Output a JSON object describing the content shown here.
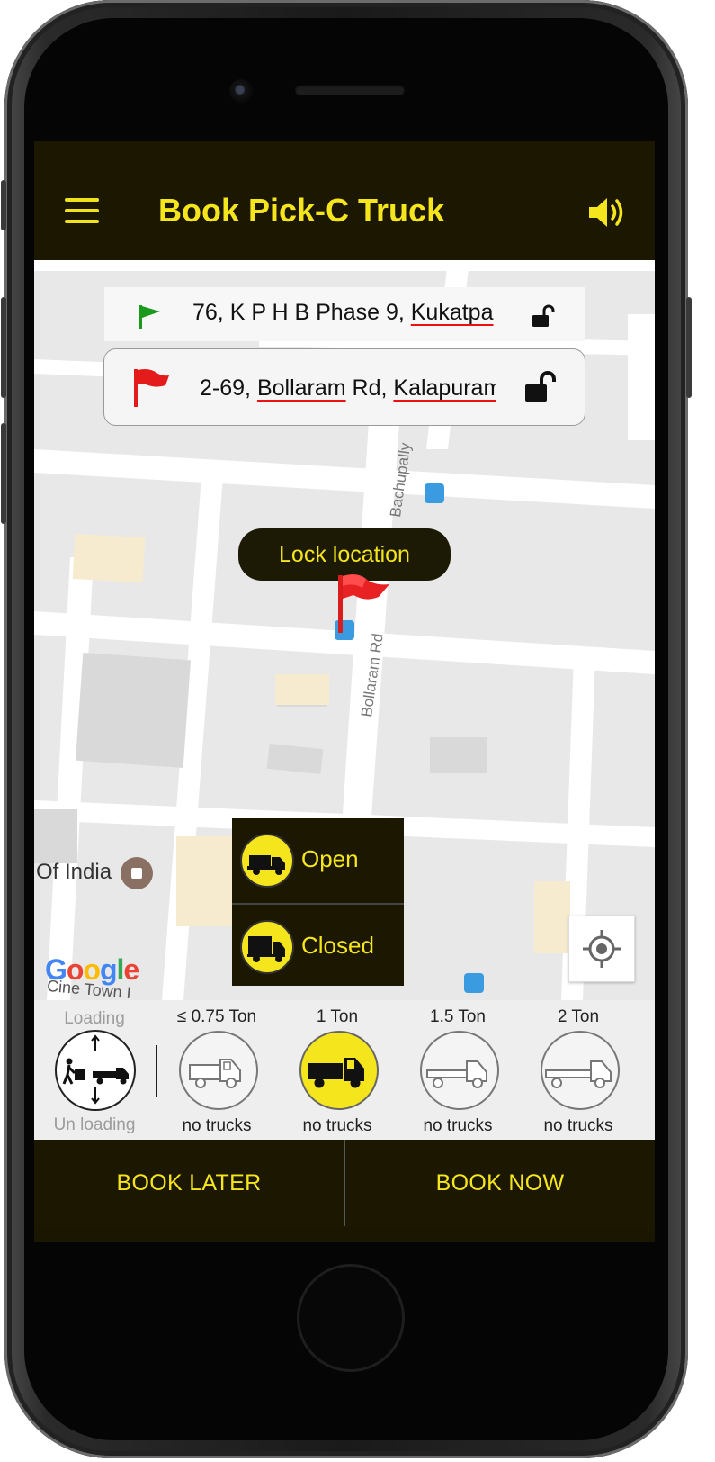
{
  "app": {
    "title": "Book Pick-C Truck",
    "menu_icon": "hamburger-menu-icon",
    "sound_icon": "speaker-volume-icon"
  },
  "colors": {
    "accent": "#f5e51c",
    "bar_background": "#1b1700",
    "pickup_flag": "#1a9a1a",
    "drop_flag": "#e41b1b"
  },
  "locations": {
    "pickup": {
      "icon": "green-flag-icon",
      "address": "76, K P H B Phase 9, Kukatpa",
      "address_plain": "76, K P H B Phase 9, ",
      "address_under": "Kukatpa",
      "lock_icon": "unlocked-padlock-icon"
    },
    "drop": {
      "icon": "red-flag-icon",
      "address": "2-69, Bollaram Rd, Kalapuram",
      "part1": "2-69, ",
      "part2": "Bollaram",
      "part3": " Rd, ",
      "part4": "Kalapuram",
      "lock_icon": "unlocked-padlock-icon"
    }
  },
  "map": {
    "lock_button": "Lock location",
    "road_bachupally": "Bachupally",
    "road_bollaram": "Bollaram Rd",
    "poi_label": "Of India",
    "google_logo": "Google",
    "cine_label": "Cine Town I",
    "gps_icon": "my-location-icon"
  },
  "truck_type_menu": {
    "items": [
      {
        "label": "Open",
        "icon": "open-truck-icon"
      },
      {
        "label": "Closed",
        "icon": "closed-truck-icon"
      }
    ]
  },
  "service": {
    "top_label": "Loading",
    "bottom_label": "Un loading",
    "icon": "loading-unloading-icon"
  },
  "trucks": [
    {
      "capacity": "≤ 0.75 Ton",
      "status": "no trucks",
      "selected": false
    },
    {
      "capacity": "1 Ton",
      "status": "no trucks",
      "selected": true
    },
    {
      "capacity": "1.5 Ton",
      "status": "no trucks",
      "selected": false
    },
    {
      "capacity": "2 Ton",
      "status": "no trucks",
      "selected": false
    }
  ],
  "actions": {
    "book_later": "BOOK LATER",
    "book_now": "BOOK NOW"
  }
}
